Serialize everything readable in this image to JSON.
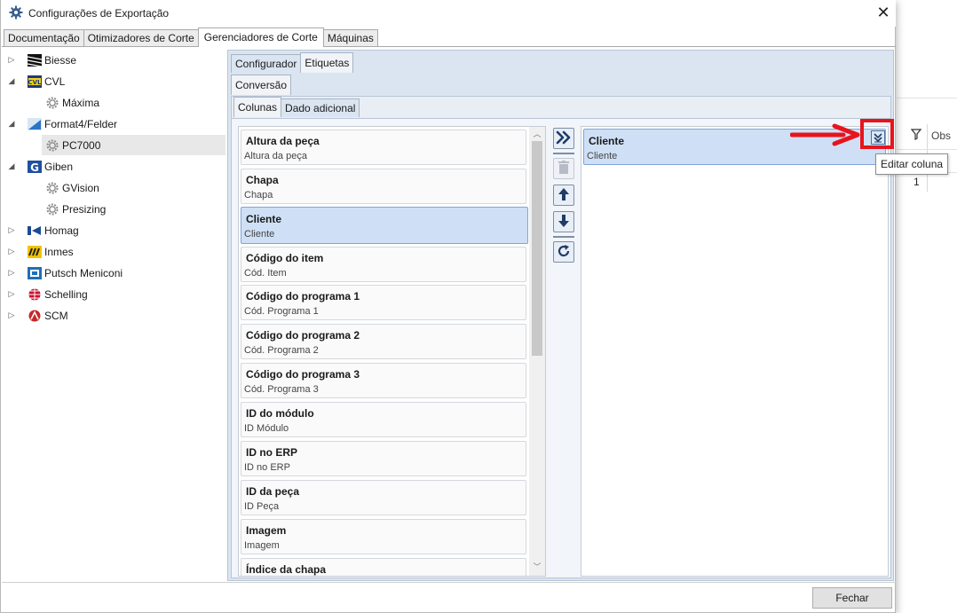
{
  "window": {
    "title": "Configurações de Exportação"
  },
  "top_tabs": [
    {
      "label": "Documentação",
      "active": false
    },
    {
      "label": "Otimizadores de Corte",
      "active": false
    },
    {
      "label": "Gerenciadores de Corte",
      "active": true
    },
    {
      "label": "Máquinas",
      "active": false
    }
  ],
  "tree": [
    {
      "label": "Biesse",
      "level": 0,
      "expanded": false,
      "icon": "biesse-logo-icon"
    },
    {
      "label": "CVL",
      "level": 0,
      "expanded": true,
      "icon": "cvl-logo-icon"
    },
    {
      "label": "Máxima",
      "level": 1,
      "icon": "gear-icon"
    },
    {
      "label": "Format4/Felder",
      "level": 0,
      "expanded": true,
      "icon": "format4-logo-icon"
    },
    {
      "label": "PC7000",
      "level": 1,
      "icon": "gear-icon",
      "selected": true
    },
    {
      "label": "Giben",
      "level": 0,
      "expanded": true,
      "icon": "giben-logo-icon"
    },
    {
      "label": "GVision",
      "level": 1,
      "icon": "gear-icon"
    },
    {
      "label": "Presizing",
      "level": 1,
      "icon": "gear-icon"
    },
    {
      "label": "Homag",
      "level": 0,
      "expanded": false,
      "icon": "homag-logo-icon"
    },
    {
      "label": "Inmes",
      "level": 0,
      "expanded": false,
      "icon": "inmes-logo-icon"
    },
    {
      "label": "Putsch Meniconi",
      "level": 0,
      "expanded": false,
      "icon": "putsch-logo-icon"
    },
    {
      "label": "Schelling",
      "level": 0,
      "expanded": false,
      "icon": "schelling-logo-icon"
    },
    {
      "label": "SCM",
      "level": 0,
      "expanded": false,
      "icon": "scm-logo-icon"
    }
  ],
  "panel": {
    "tabs": [
      {
        "label": "Configurador",
        "active": false
      },
      {
        "label": "Etiquetas",
        "active": true
      }
    ],
    "sub_tab": "Conversão",
    "inner_tabs": [
      {
        "label": "Colunas",
        "active": true
      },
      {
        "label": "Dado adicional",
        "active": false
      }
    ]
  },
  "available_columns": [
    {
      "title": "Altura da peça",
      "subtitle": "Altura da peça"
    },
    {
      "title": "Chapa",
      "subtitle": "Chapa"
    },
    {
      "title": "Cliente",
      "subtitle": "Cliente",
      "selected": true
    },
    {
      "title": "Código do item",
      "subtitle": "Cód. Item"
    },
    {
      "title": "Código do programa 1",
      "subtitle": "Cód. Programa 1"
    },
    {
      "title": "Código do programa 2",
      "subtitle": "Cód. Programa 2"
    },
    {
      "title": "Código do programa 3",
      "subtitle": "Cód. Programa 3"
    },
    {
      "title": "ID do módulo",
      "subtitle": "ID Módulo"
    },
    {
      "title": "ID no ERP",
      "subtitle": "ID no ERP"
    },
    {
      "title": "ID da peça",
      "subtitle": "ID Peça"
    },
    {
      "title": "Imagem",
      "subtitle": "Imagem"
    },
    {
      "title": "Índice da chapa",
      "subtitle": ""
    }
  ],
  "selected_columns": [
    {
      "title": "Cliente",
      "subtitle": "Cliente"
    }
  ],
  "middle_buttons": [
    "add-all-icon",
    "delete-icon",
    "move-up-icon",
    "move-down-icon",
    "refresh-icon"
  ],
  "tooltip": "Editar coluna",
  "footer": {
    "close_label": "Fechar"
  },
  "background": {
    "col_header": "Obs",
    "row_value": "1"
  },
  "colors": {
    "accent": "#cfe0f6",
    "panel": "#dbe5f1",
    "annotation": "#e8141c"
  }
}
